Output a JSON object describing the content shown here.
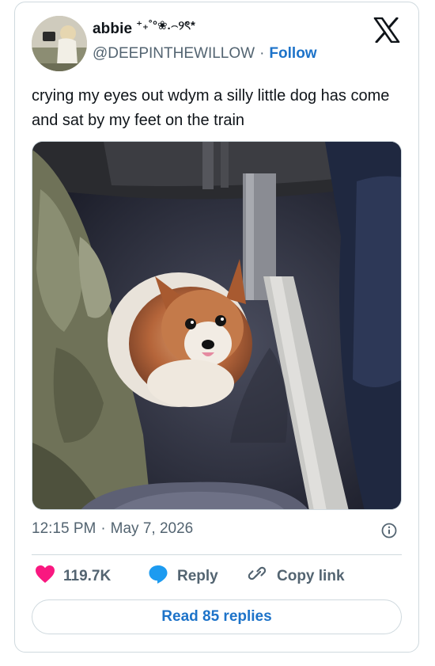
{
  "author": {
    "display_name": "abbie",
    "name_decoration": "⁺₊˚°❀.⌢୨ৎ*",
    "handle": "@DEEPINTHEWILLOW",
    "separator": "·",
    "follow_label": "Follow"
  },
  "tweet": {
    "text": "crying my eyes out wdym a silly little dog has come and sat by my feet on the train",
    "time": "12:15 PM",
    "separator": "·",
    "date": "May 7, 2026"
  },
  "actions": {
    "like_count": "119.7K",
    "reply_label": "Reply",
    "copy_link_label": "Copy link"
  },
  "read_replies_label": "Read 85 replies",
  "colors": {
    "link_blue": "#1d73c9",
    "heart_red": "#f91880",
    "reply_blue": "#1d9bf0",
    "muted_gray": "#536471",
    "border": "#cfd9de"
  }
}
